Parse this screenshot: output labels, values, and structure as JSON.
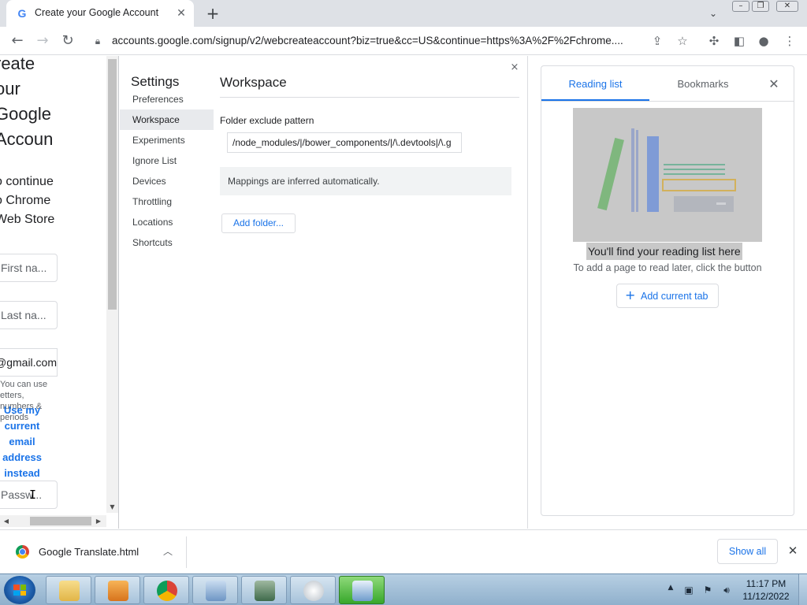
{
  "browser": {
    "tab_title": "Create your Google Account",
    "tab_favicon": "G",
    "url": "accounts.google.com/signup/v2/webcreateaccount?biz=true&cc=US&continue=https%3A%2F%2Fchrome...."
  },
  "page": {
    "heading": "reate\nour\nGoogle\nAccoun",
    "subheading": "o continue\no Chrome\nWeb Store",
    "first_name_placeholder": "First na...",
    "last_name_placeholder": "Last na...",
    "gmail_suffix": "@gmail.com",
    "username_hint": "You can use\netters,\nnumbers &\nperiods",
    "use_email_link": "Use my current email address instead",
    "password_placeholder": "Passw..."
  },
  "devtools": {
    "settings_title": "Settings",
    "nav": [
      {
        "label": "Preferences",
        "selected": false
      },
      {
        "label": "Workspace",
        "selected": true
      },
      {
        "label": "Experiments",
        "selected": false
      },
      {
        "label": "Ignore List",
        "selected": false
      },
      {
        "label": "Devices",
        "selected": false
      },
      {
        "label": "Throttling",
        "selected": false
      },
      {
        "label": "Locations",
        "selected": false
      },
      {
        "label": "Shortcuts",
        "selected": false
      }
    ],
    "close_glyph": "×",
    "workspace_title": "Workspace",
    "exclude_label": "Folder exclude pattern",
    "exclude_value": "/node_modules/|/bower_components/|/\\.devtools|/\\.g",
    "mappings_note": "Mappings are inferred automatically.",
    "add_folder_label": "Add folder..."
  },
  "side_panel": {
    "tabs": [
      "Reading list",
      "Bookmarks"
    ],
    "active_tab": "Reading list",
    "empty_title": "You'll find your reading list here",
    "empty_subtitle": "To add a page to read later, click the button",
    "add_current_tab_label": "Add current tab"
  },
  "download_bar": {
    "file_name": "Google Translate.html",
    "show_all_label": "Show all"
  },
  "taskbar": {
    "time": "11:17 PM",
    "date": "11/12/2022"
  },
  "colors": {
    "accent": "#1a73e8",
    "tab_strip": "#dee1e6",
    "selected_nav": "#e8eaed",
    "taskbar_active": "#37a72a"
  }
}
